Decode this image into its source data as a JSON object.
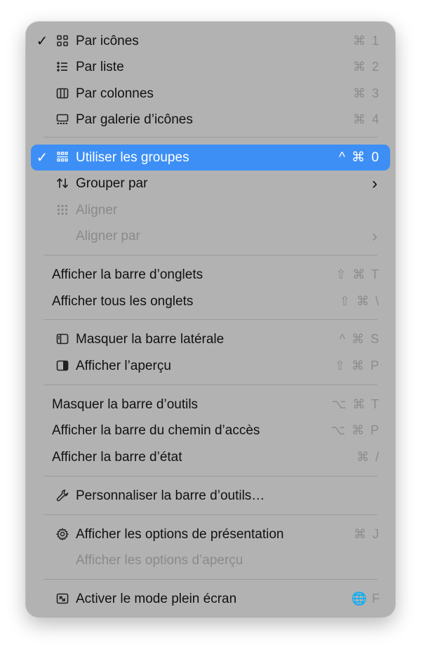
{
  "menu": {
    "items": [
      {
        "label": "Par icônes",
        "shortcut": "⌘ 1",
        "icon": "grid-icon",
        "checked": true
      },
      {
        "label": "Par liste",
        "shortcut": "⌘ 2",
        "icon": "list-icon"
      },
      {
        "label": "Par colonnes",
        "shortcut": "⌘ 3",
        "icon": "columns-icon"
      },
      {
        "label": "Par galerie d’icônes",
        "shortcut": "⌘ 4",
        "icon": "gallery-icon"
      },
      {
        "label": "Utiliser les groupes",
        "shortcut": "^ ⌘ 0",
        "icon": "groups-icon",
        "checked": true,
        "selected": true
      },
      {
        "label": "Grouper par",
        "shortcut": "›",
        "icon": "sort-arrows-icon"
      },
      {
        "label": "Aligner",
        "shortcut": "",
        "icon": "align-grid-icon",
        "disabled": true
      },
      {
        "label": "Aligner par",
        "shortcut": "›",
        "disabled": true
      },
      {
        "label": "Afficher la barre d’onglets",
        "shortcut": "⇧ ⌘ T"
      },
      {
        "label": "Afficher tous les onglets",
        "shortcut": "⇧ ⌘ \\"
      },
      {
        "label": "Masquer la barre latérale",
        "shortcut": "^ ⌘ S",
        "icon": "sidebar-icon"
      },
      {
        "label": "Afficher l’aperçu",
        "shortcut": "⇧ ⌘ P",
        "icon": "preview-pane-icon"
      },
      {
        "label": "Masquer la barre d’outils",
        "shortcut": "⌥ ⌘ T"
      },
      {
        "label": "Afficher la barre du chemin d’accès",
        "shortcut": "⌥ ⌘ P"
      },
      {
        "label": "Afficher la barre d’état",
        "shortcut": "⌘ /"
      },
      {
        "label": "Personnaliser la barre d’outils…",
        "shortcut": "",
        "icon": "wrench-icon"
      },
      {
        "label": "Afficher les options de présentation",
        "shortcut": "⌘ J",
        "icon": "gear-icon"
      },
      {
        "label": "Afficher les options d’aperçu",
        "shortcut": "",
        "disabled": true
      },
      {
        "label": "Activer le mode plein écran",
        "shortcut": "🌐 F",
        "icon": "fullscreen-icon"
      }
    ],
    "checkmark": "✓"
  }
}
